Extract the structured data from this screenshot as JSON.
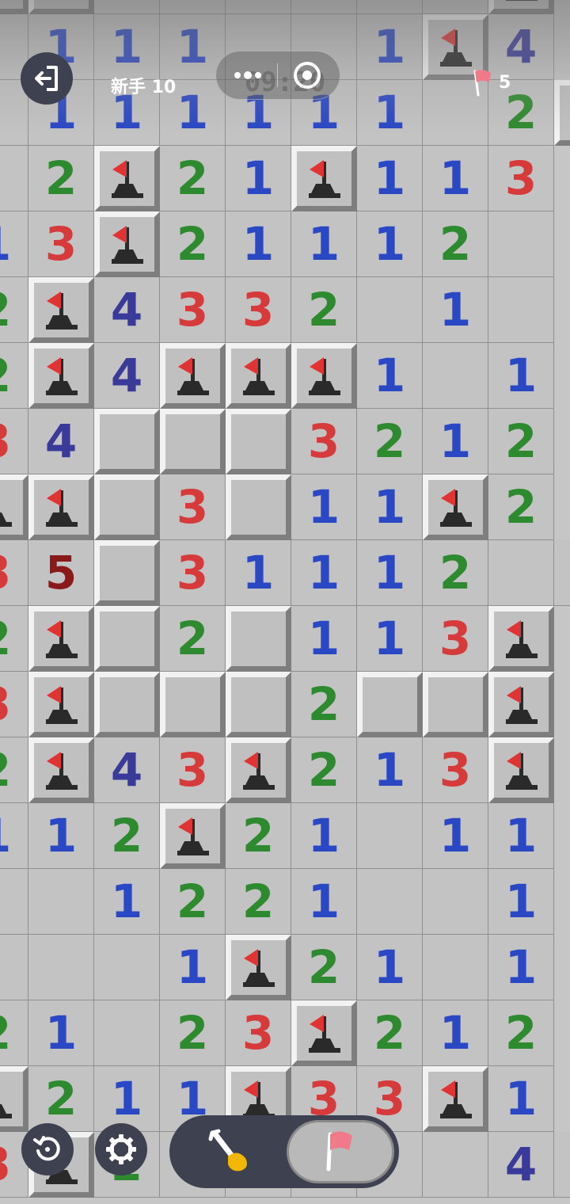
{
  "header": {
    "level_label": "新手 10",
    "timer": "09:20",
    "flags_remaining": "5"
  },
  "icons": {
    "exit": "exit-icon",
    "menu": "more-dots-icon",
    "close_miniprogram": "target-close-icon",
    "flag_counter": "flag-icon",
    "restart": "restart-icon",
    "settings": "gear-icon",
    "dig_mode": "shovel-icon",
    "flag_mode": "flag-icon"
  },
  "colors": {
    "one": "#2a47c4",
    "two": "#2e8a2e",
    "three": "#d63a3a",
    "four": "#3a3a9a",
    "five": "#8a1a1a",
    "hud_button": "#3d4150",
    "flag": "#e03434"
  },
  "mode": {
    "active": "flag"
  },
  "board": {
    "legend": "F = flagged, H = unopened, . = empty opened, digits = adjacent mine count",
    "rows": [
      "HH1.1.22F",
      ".111..1F4",
      ".111111.2F",
      ".2F21F113",
      "13F21112.",
      "2F4332.1.",
      "2F4FFF1.1",
      "34HHH3212",
      "FFH3H11F2",
      "35H31112.3",
      "2FH2H113F",
      "3FHHH2HHF",
      "2F43F213F",
      "112F21.11",
      "..1221..1",
      "...1F21.1",
      "21.23F212",
      "F211F33F1",
      "3F2.....42"
    ]
  }
}
